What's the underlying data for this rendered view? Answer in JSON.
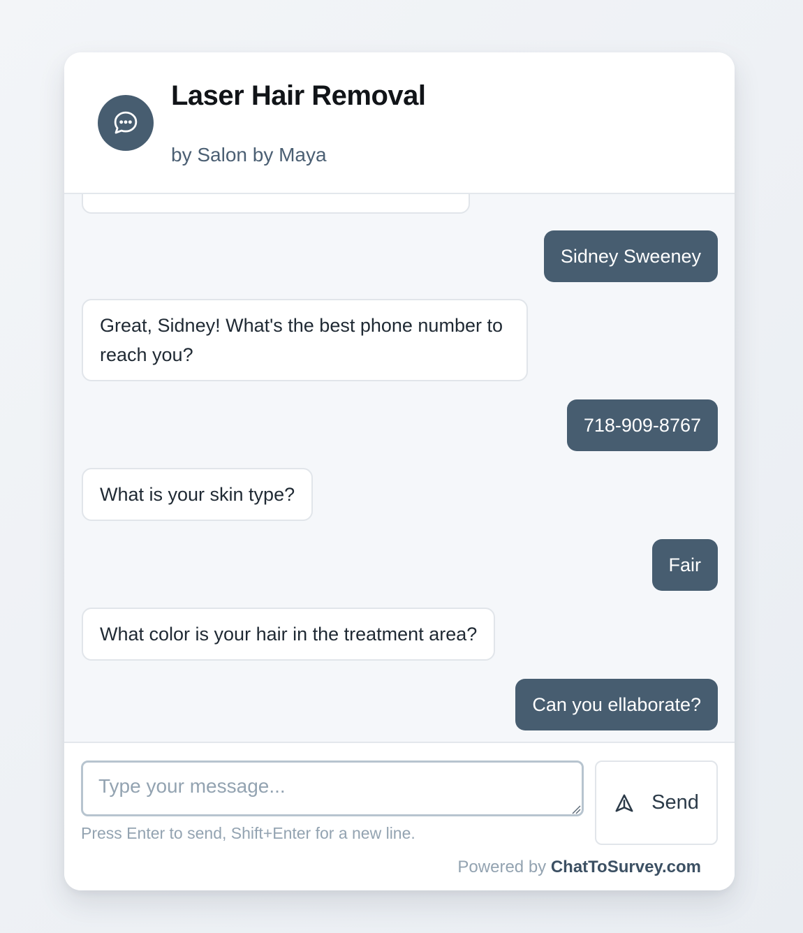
{
  "header": {
    "title": "Laser Hair Removal",
    "subtitle": "by Salon by Maya",
    "avatar_icon": "chat-bubble-icon"
  },
  "messages": [
    {
      "role": "bot",
      "text": ""
    },
    {
      "role": "user",
      "text": "Sidney Sweeney"
    },
    {
      "role": "bot",
      "text": "Great, Sidney! What's the best phone number to reach you?"
    },
    {
      "role": "user",
      "text": "718-909-8767"
    },
    {
      "role": "bot",
      "text": "What is your skin type?"
    },
    {
      "role": "user",
      "text": "Fair"
    },
    {
      "role": "bot",
      "text": "What color is your hair in the treatment area?"
    },
    {
      "role": "user",
      "text": "Can you ellaborate?"
    }
  ],
  "composer": {
    "value": "",
    "placeholder": "Type your message...",
    "hint": "Press Enter to send, Shift+Enter for a new line.",
    "send_label": "Send",
    "send_icon": "send-icon"
  },
  "footer": {
    "powered_prefix": "Powered by",
    "powered_link": "ChatToSurvey.com"
  },
  "colors": {
    "accent": "#475d70",
    "background": "#f5f7fa",
    "bot_bubble": "#ffffff",
    "user_text": "#ffffff"
  }
}
